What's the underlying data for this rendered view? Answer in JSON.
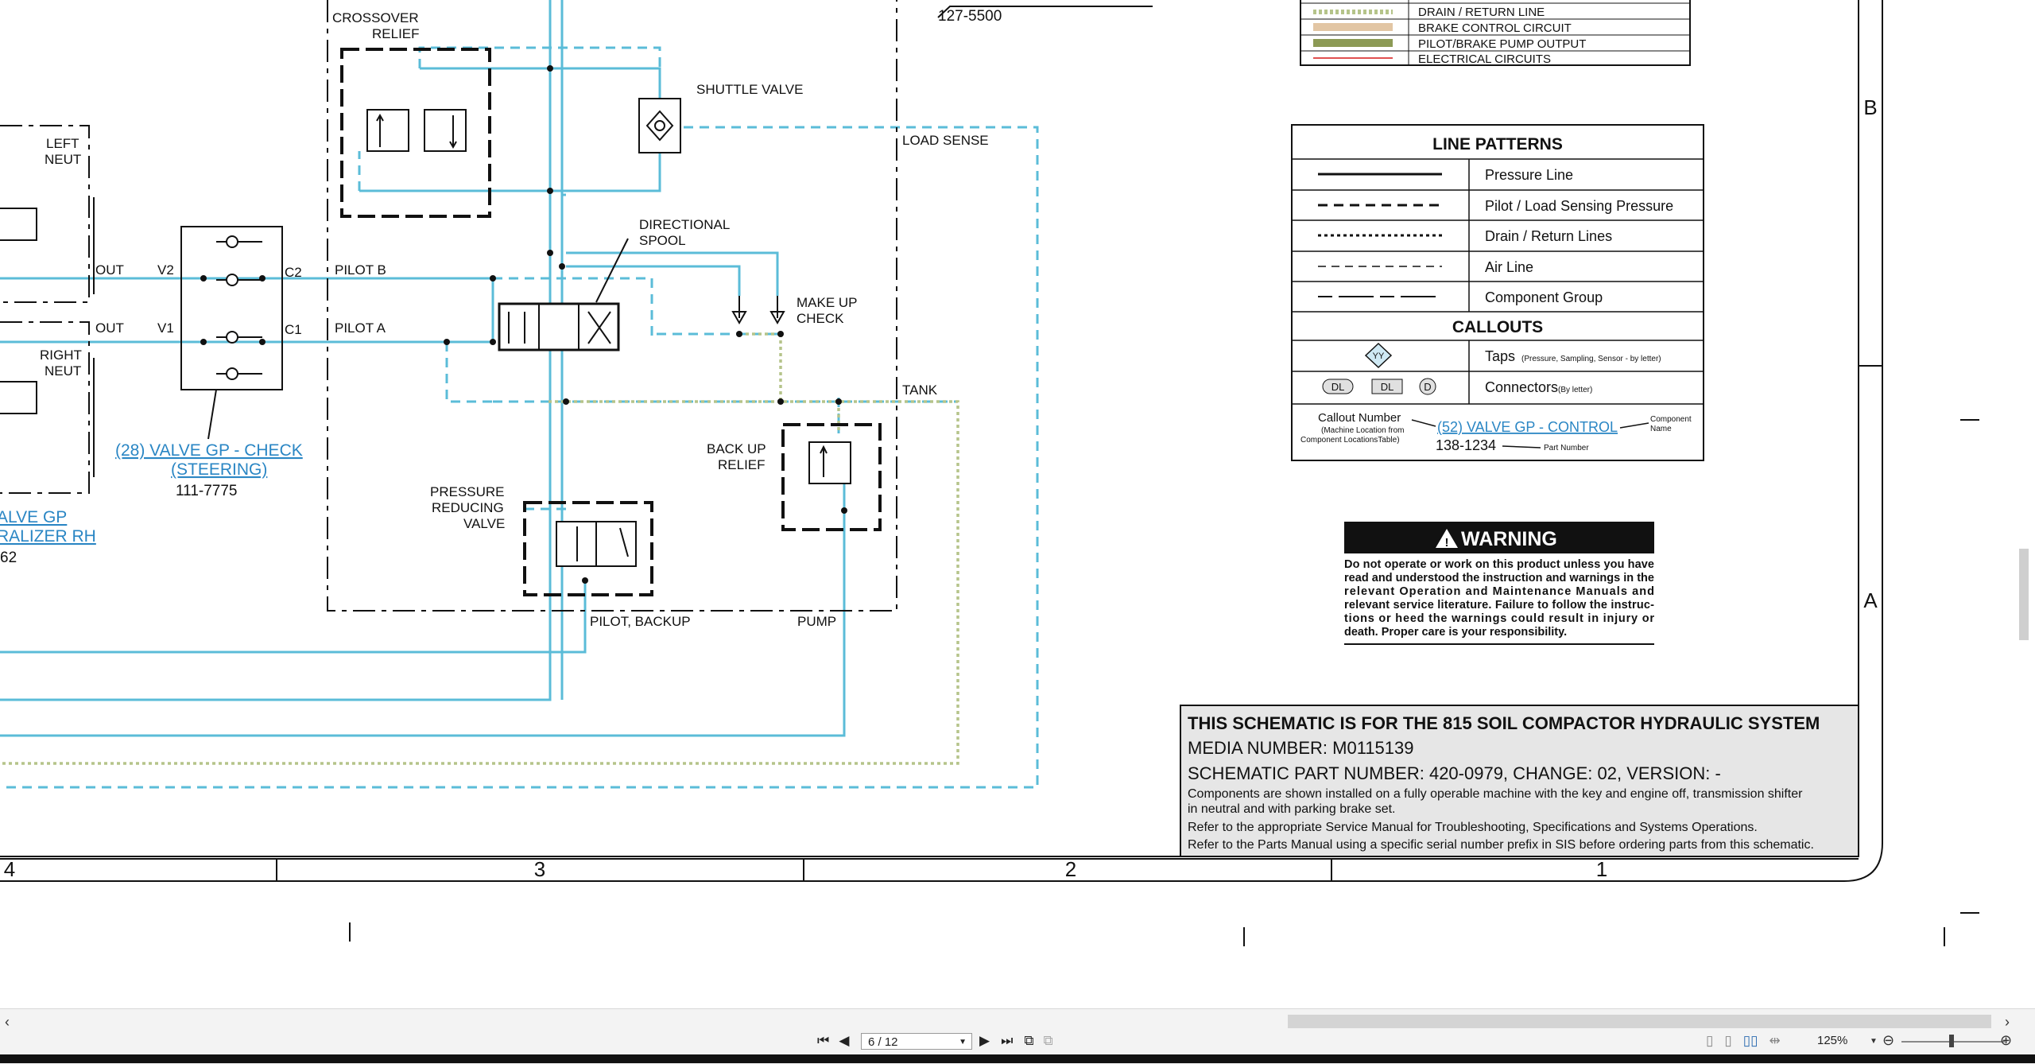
{
  "colors": {
    "pressure": "#5bbcd8",
    "drain": "#b5c48a",
    "dark": "#111111",
    "link": "#2a86c4",
    "brake": "#e2c6a4",
    "pilot_brake": "#8c9a55",
    "electrical": "#e05050"
  },
  "partial_top": {
    "label": "127-5500"
  },
  "valves": {
    "crossover": [
      "CROSSOVER",
      "RELIEF"
    ],
    "shuttle": "SHUTTLE VALVE",
    "load_sense": "LOAD SENSE",
    "directional": [
      "DIRECTIONAL",
      "SPOOL"
    ],
    "makeup": [
      "MAKE UP",
      "CHECK"
    ],
    "pilot_b": "PILOT B",
    "pilot_a": "PILOT A",
    "tank": "TANK",
    "backup_relief": [
      "BACK UP",
      "RELIEF"
    ],
    "pressure_reducing": [
      "PRESSURE",
      "REDUCING",
      "VALVE"
    ],
    "pilot_backup": "PILOT, BACKUP",
    "pump": "PUMP",
    "left_neut": [
      "LEFT",
      "NEUT"
    ],
    "right_neut": [
      "RIGHT",
      "NEUT"
    ],
    "out": "OUT",
    "v1": "V1",
    "v2": "V2",
    "c1": "C1",
    "c2": "C2",
    "check_link": [
      "(28) VALVE GP - CHECK",
      "(STEERING)"
    ],
    "check_part": "111-7775",
    "equalizer_link": [
      "ALVE GP",
      "RALIZER RH"
    ],
    "equalizer_part": "62"
  },
  "legend_top": [
    "DRAIN / RETURN LINE",
    "BRAKE CONTROL CIRCUIT",
    "PILOT/BRAKE PUMP OUTPUT",
    "ELECTRICAL CIRCUITS"
  ],
  "line_patterns": {
    "title": "LINE PATTERNS",
    "rows": [
      "Pressure Line",
      "Pilot / Load Sensing Pressure",
      "Drain / Return Lines",
      "Air Line",
      "Component Group"
    ]
  },
  "callouts": {
    "title": "CALLOUTS",
    "tap_symbol": "YY",
    "taps": "Taps",
    "taps_note": "(Pressure, Sampling, Sensor - by letter)",
    "conn_dl": "DL",
    "conn_d": "D",
    "connectors": "Connectors",
    "connectors_note": "(By letter)",
    "callout_number": "Callout Number",
    "callout_note1": "(Machine Location from",
    "callout_note2": "Component LocationsTable)",
    "example_link": "(52) VALVE GP - CONTROL",
    "component_name1": "Component",
    "component_name2": "Name",
    "example_part": "138-1234",
    "part_number": "Part Number"
  },
  "warning": {
    "title": "WARNING",
    "lines": [
      "Do not operate or work on this product unless you have",
      "read and understood the instruction and warnings in the",
      "relevant Operation and Maintenance Manuals and",
      "relevant service literature. Failure to follow the instruc-",
      "tions or heed the warnings could result in injury or",
      "death. Proper care is your responsibility."
    ]
  },
  "title_block": {
    "title": "THIS SCHEMATIC IS FOR THE 815 SOIL COMPACTOR HYDRAULIC SYSTEM",
    "media": "MEDIA NUMBER: M0115139",
    "part": "SCHEMATIC PART NUMBER: 420-0979, CHANGE: 02, VERSION: -",
    "note1": "Components are shown installed on a fully operable machine with the key and engine off, transmission shifter",
    "note1b": "in neutral and with parking brake set.",
    "note2": "Refer to the appropriate Service Manual for Troubleshooting, Specifications and Systems Operations.",
    "note3": "Refer to the Parts Manual using a specific serial number prefix in SIS before ordering parts from this schematic."
  },
  "grid": {
    "cols": [
      "4",
      "3",
      "2",
      "1"
    ],
    "rows": [
      "B",
      "A"
    ]
  },
  "viewer": {
    "page": "6 / 12",
    "zoom": "125%"
  }
}
